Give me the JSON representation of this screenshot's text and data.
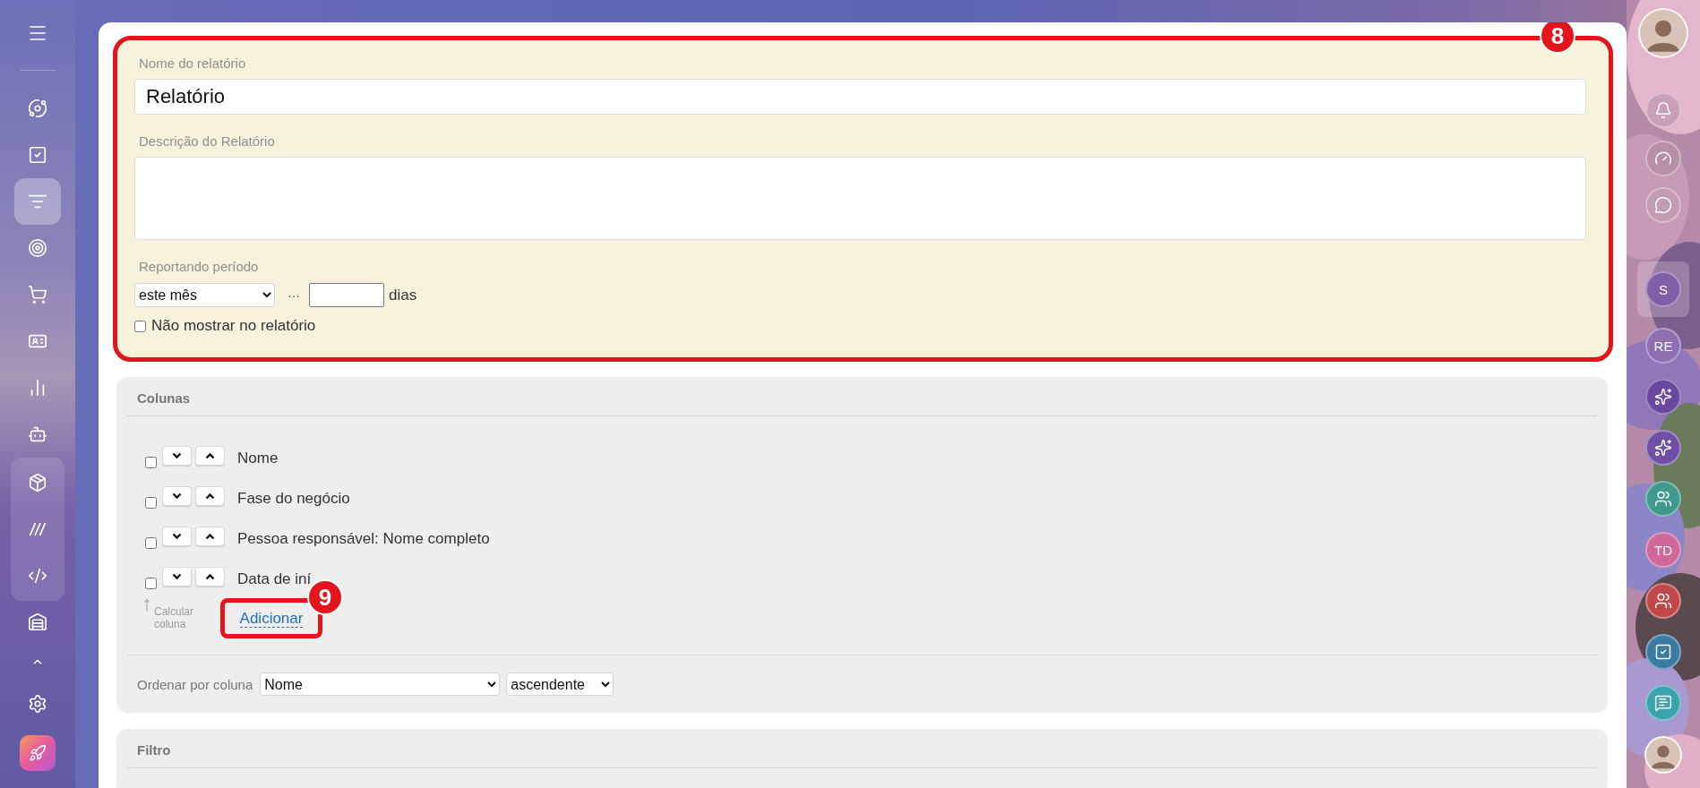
{
  "nav": {
    "items": [
      {
        "selected": false
      },
      {
        "selected": false
      },
      {
        "selected": true
      },
      {
        "selected": false
      },
      {
        "selected": false
      },
      {
        "selected": false
      },
      {
        "selected": false
      },
      {
        "selected": false
      }
    ],
    "group_items": [
      {
        "selected": false
      },
      {
        "selected": false
      },
      {
        "selected": false
      }
    ],
    "footer_items": [
      {
        "selected": false
      }
    ]
  },
  "report": {
    "name_label": "Nome do relatório",
    "name_value": "Relatório",
    "description_label": "Descrição do Relatório",
    "period_label": "Reportando período",
    "period_value": "este mês",
    "period_separator": "···",
    "days_unit": "dias",
    "hide_option": {
      "label": "Não mostrar no relatório",
      "checked": false
    },
    "badge": "8"
  },
  "columns_panel": {
    "title": "Colunas",
    "rows": [
      {
        "label": "Nome",
        "checked": false
      },
      {
        "label": "Fase do negócio",
        "checked": false
      },
      {
        "label": "Pessoa responsável: Nome completo",
        "checked": false
      },
      {
        "label": "Data de iní",
        "checked": false
      }
    ],
    "calc_hint": "Calcular coluna",
    "add_link": "Adicionar",
    "badge": "9",
    "sort_label": "Ordenar por coluna",
    "sort_column": "Nome",
    "sort_order": "ascendente"
  },
  "filter_panel": {
    "title": "Filtro"
  },
  "right_sidebar": {
    "items": [
      {
        "kind": "avatar",
        "selected": false
      },
      {
        "kind": "icon",
        "selected": false,
        "color": "#c9a0b8"
      },
      {
        "kind": "icon",
        "selected": false,
        "color": "#b88fa8"
      },
      {
        "kind": "icon",
        "selected": false,
        "color": "#c29bb5"
      },
      {
        "kind": "initials",
        "text": "S",
        "selected": true,
        "color": "#7f5fa6"
      },
      {
        "kind": "initials",
        "text": "RE",
        "selected": false,
        "color": "#8e6fb4"
      },
      {
        "kind": "icon",
        "selected": false,
        "color": "#6a48a0"
      },
      {
        "kind": "icon",
        "selected": false,
        "color": "#7050a6"
      },
      {
        "kind": "icon",
        "selected": false,
        "color": "#3f9a8c"
      },
      {
        "kind": "initials",
        "text": "TD",
        "selected": false,
        "color": "#d0689a"
      },
      {
        "kind": "icon",
        "selected": false,
        "color": "#c04848"
      },
      {
        "kind": "icon",
        "selected": false,
        "color": "#3a7aa3"
      },
      {
        "kind": "icon",
        "selected": false,
        "color": "#3aa3ad"
      },
      {
        "kind": "avatar",
        "selected": false
      }
    ]
  }
}
